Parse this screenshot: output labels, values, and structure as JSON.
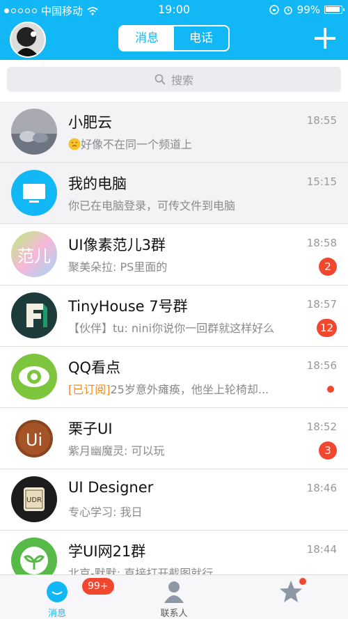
{
  "status_bar": {
    "carrier": "中国移动",
    "time": "19:00",
    "battery": "99%"
  },
  "header": {
    "tabs": [
      {
        "label": "消息",
        "active": true
      },
      {
        "label": "电话",
        "active": false
      }
    ]
  },
  "search": {
    "placeholder": "搜索"
  },
  "conversations": [
    {
      "name": "小肥云",
      "time": "18:55",
      "message": "好像不在同一个频道上",
      "pinned": true
    },
    {
      "name": "我的电脑",
      "time": "15:15",
      "message": "你已在电脑登录，可传文件到电脑",
      "pinned": true
    },
    {
      "name": "UI像素范儿3群",
      "time": "18:58",
      "message": "聚美朵拉: PS里面的",
      "badge": "2"
    },
    {
      "name": "TinyHouse 7号群",
      "time": "18:57",
      "message": "【伙伴】tu: nini你说你一回群就这样好么",
      "badge": "12"
    },
    {
      "name": "QQ看点",
      "time": "18:56",
      "tag": "[已订阅]",
      "message": "25岁意外瘫痪，他坐上轮椅却...",
      "dot": true
    },
    {
      "name": "栗子UI",
      "time": "18:52",
      "message": "紫月幽魔灵: 可以玩",
      "badge": "3"
    },
    {
      "name": "UI Designer",
      "time": "18:46",
      "message": "专心学习: 我日"
    },
    {
      "name": "学UI网21群",
      "time": "18:44",
      "message": "北京-默默: 直接打开截图就行"
    }
  ],
  "tabbar": {
    "tabs": [
      {
        "label": "消息",
        "active": true,
        "badge": "99+"
      },
      {
        "label": "联系人",
        "active": false
      },
      {
        "label": "",
        "active": false,
        "dot": true
      }
    ]
  },
  "colors": {
    "accent": "#12b7f5",
    "badge": "#f2472f",
    "tag": "#f08a1c"
  }
}
